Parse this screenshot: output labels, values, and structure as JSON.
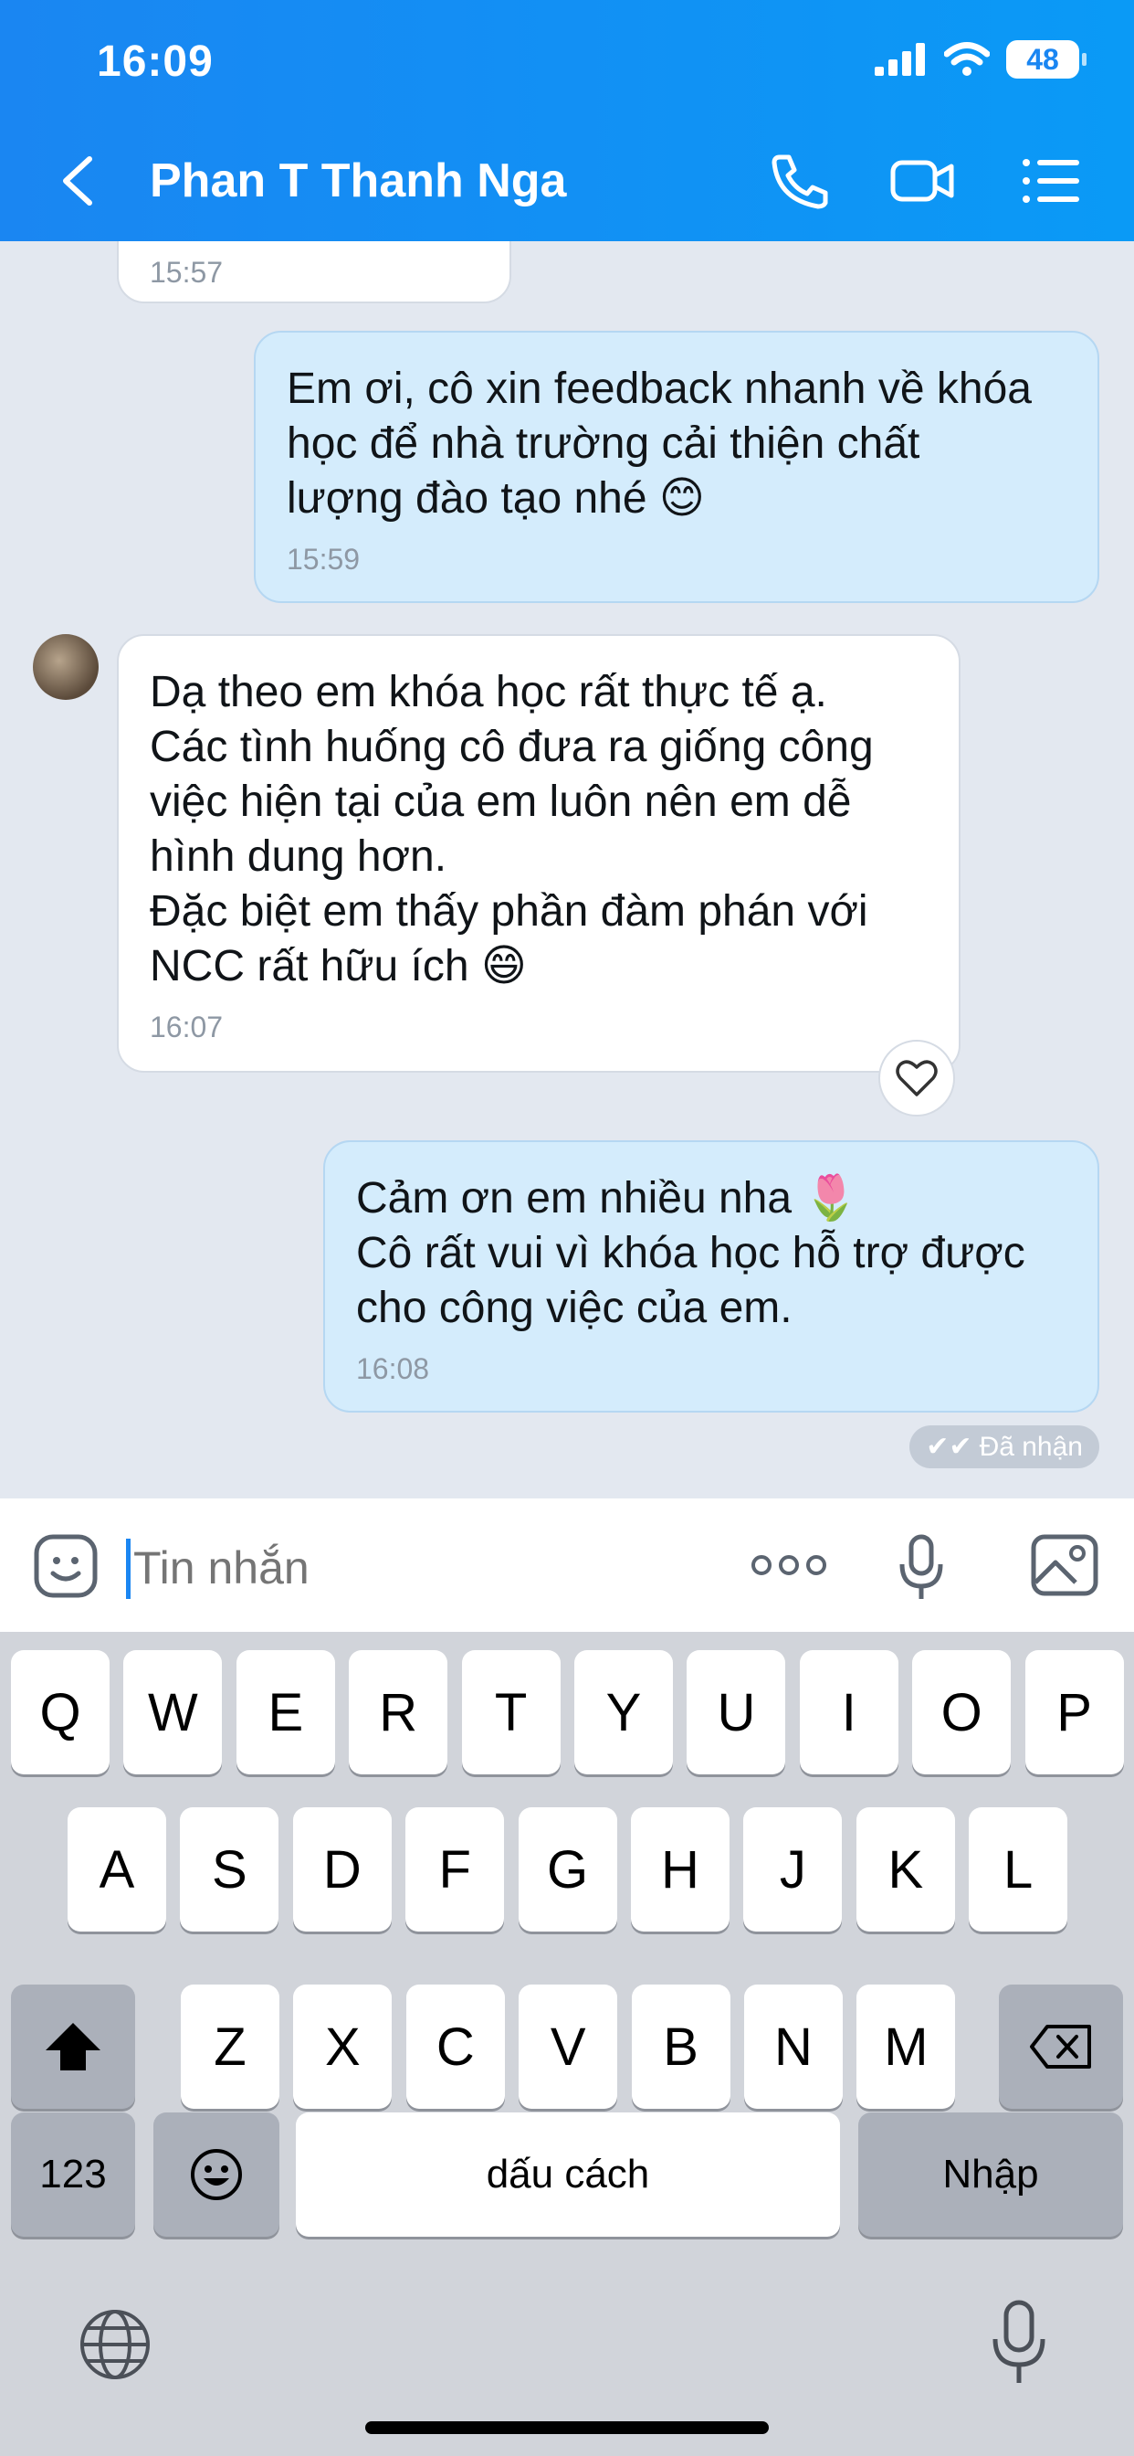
{
  "status_bar": {
    "time": "16:09",
    "battery": "48"
  },
  "header": {
    "title": "Phan T Thanh Nga"
  },
  "messages": {
    "prev_in": {
      "time": "15:57"
    },
    "out1": {
      "text": "Em ơi, cô xin feedback nhanh về khóa\nhọc để nhà trường cải thiện chất\nlượng đào tạo nhé 😊",
      "time": "15:59"
    },
    "in1": {
      "text": "Dạ theo em khóa học rất thực tế ạ.\nCác tình huống cô đưa ra giống công\nviệc hiện tại của em luôn nên em dễ\nhình dung hơn.\nĐặc biệt em thấy phần đàm phán với\nNCC rất hữu ích 😄",
      "time": "16:07"
    },
    "out2": {
      "text": "Cảm ơn em nhiều nha 🌷\nCô rất vui vì khóa học hỗ trợ được\ncho công việc của em.",
      "time": "16:08"
    },
    "status": "Đã nhận"
  },
  "input": {
    "placeholder": "Tin nhắn"
  },
  "keyboard": {
    "row1": [
      "Q",
      "W",
      "E",
      "R",
      "T",
      "Y",
      "U",
      "I",
      "O",
      "P"
    ],
    "row2": [
      "A",
      "S",
      "D",
      "F",
      "G",
      "H",
      "J",
      "K",
      "L"
    ],
    "row3": [
      "Z",
      "X",
      "C",
      "V",
      "B",
      "N",
      "M"
    ],
    "numbers_key": "123",
    "space_key": "dấu cách",
    "return_key": "Nhập"
  },
  "colors": {
    "header": "#1a86f2",
    "outgoing_bubble": "#d4ecfc",
    "incoming_bubble": "#ffffff",
    "accent": "#1a86f2"
  }
}
